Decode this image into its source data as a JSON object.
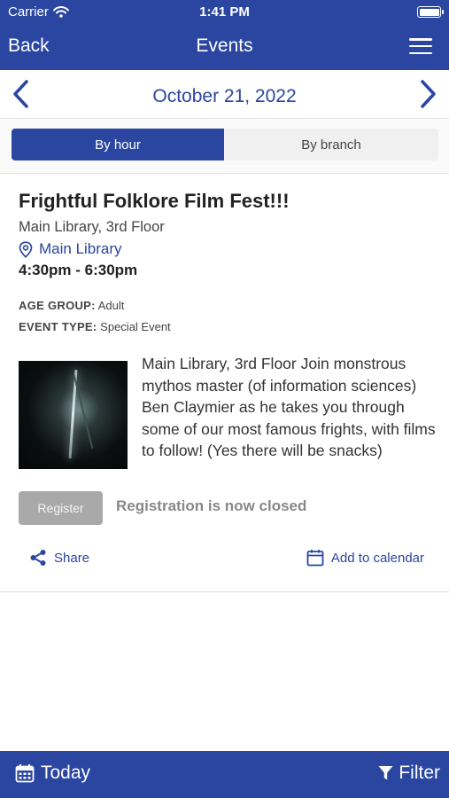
{
  "status_bar": {
    "carrier": "Carrier",
    "time": "1:41 PM"
  },
  "nav": {
    "back_label": "Back",
    "title": "Events"
  },
  "date_bar": {
    "date": "October 21, 2022"
  },
  "segments": {
    "by_hour": "By hour",
    "by_branch": "By branch",
    "selected": "By hour"
  },
  "event": {
    "title": "Frightful Folklore Film Fest!!!",
    "location": "Main Library, 3rd Floor",
    "branch": "Main Library",
    "time": "4:30pm - 6:30pm",
    "age_group_label": "AGE GROUP:",
    "age_group_value": "Adult",
    "event_type_label": "EVENT TYPE:",
    "event_type_value": "Special Event",
    "description": "Main Library, 3rd Floor Join monstrous mythos master (of information sciences) Ben Claymier as he takes you through some of our most famous frights, with films to follow! (Yes there will be snacks)",
    "register_label": "Register",
    "registration_status": "Registration is now closed",
    "share_label": "Share",
    "add_calendar_label": "Add to calendar"
  },
  "bottom_bar": {
    "today_label": "Today",
    "filter_label": "Filter"
  },
  "colors": {
    "brand_blue": "#2a46a0",
    "disabled_gray": "#a9a9a9"
  }
}
